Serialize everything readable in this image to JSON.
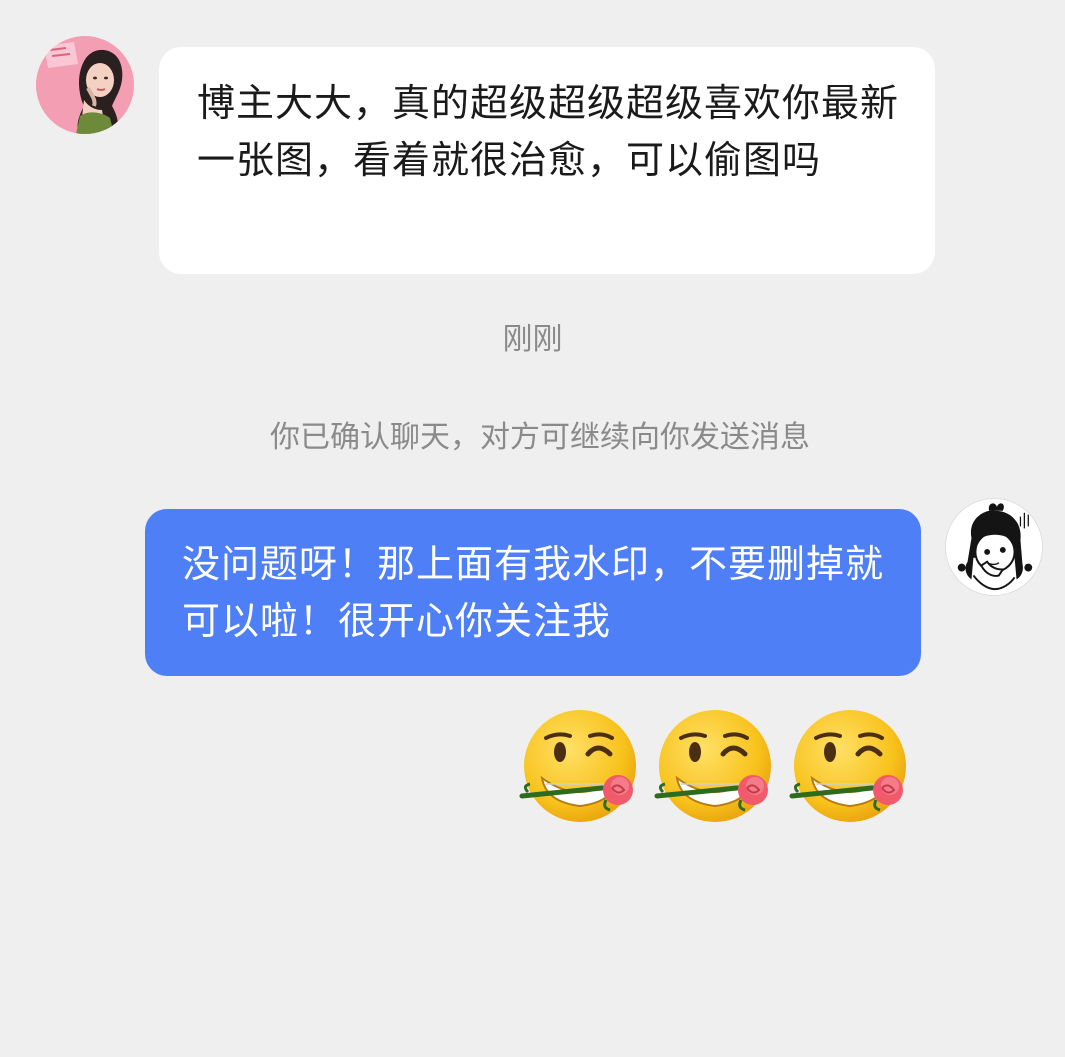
{
  "conversation": {
    "incoming_message": {
      "text": "博主大大，真的超级超级超级喜欢你最新一张图，看着就很治愈，可以偷图吗"
    },
    "timestamp": "刚刚",
    "system_notice": "你已确认聊天，对方可继续向你发送消息",
    "outgoing_message": {
      "text": "没问题呀！那上面有我水印，不要删掉就可以啦！很开心你关注我"
    },
    "emoji_reactions": [
      {
        "icon": "wink-rose-icon"
      },
      {
        "icon": "wink-rose-icon"
      },
      {
        "icon": "wink-rose-icon"
      }
    ]
  },
  "colors": {
    "background": "#efefef",
    "outgoing_bubble": "#4f7ff6",
    "incoming_bubble": "#ffffff",
    "meta_text": "#8a8a8a"
  }
}
